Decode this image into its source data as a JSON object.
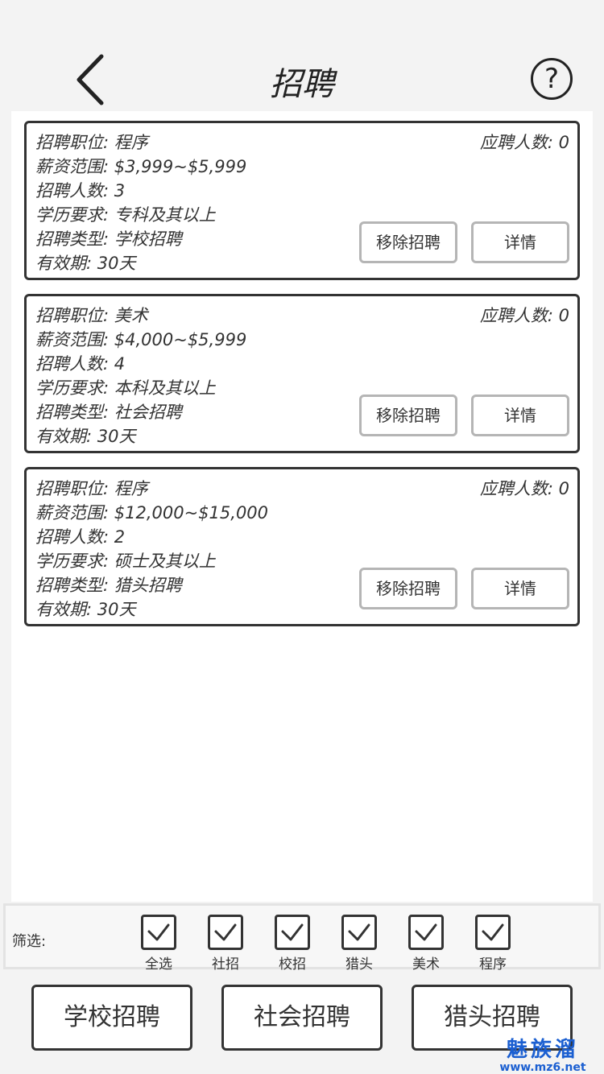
{
  "header": {
    "title": "招聘",
    "help_label": "?"
  },
  "jobs": [
    {
      "position": "招聘职位: 程序",
      "salary": "薪资范围: $3,999~$5,999",
      "headcount": "招聘人数: 3",
      "education": "学历要求: 专科及其以上",
      "type": "招聘类型: 学校招聘",
      "validity": "有效期: 30天",
      "applicants": "应聘人数: 0",
      "remove_label": "移除招聘",
      "detail_label": "详情"
    },
    {
      "position": "招聘职位: 美术",
      "salary": "薪资范围: $4,000~$5,999",
      "headcount": "招聘人数: 4",
      "education": "学历要求: 本科及其以上",
      "type": "招聘类型: 社会招聘",
      "validity": "有效期: 30天",
      "applicants": "应聘人数: 0",
      "remove_label": "移除招聘",
      "detail_label": "详情"
    },
    {
      "position": "招聘职位: 程序",
      "salary": "薪资范围: $12,000~$15,000",
      "headcount": "招聘人数: 2",
      "education": "学历要求: 硕士及其以上",
      "type": "招聘类型: 猎头招聘",
      "validity": "有效期: 30天",
      "applicants": "应聘人数: 0",
      "remove_label": "移除招聘",
      "detail_label": "详情"
    }
  ],
  "filter": {
    "label": "筛选:",
    "options": [
      {
        "label": "全选",
        "checked": true
      },
      {
        "label": "社招",
        "checked": true
      },
      {
        "label": "校招",
        "checked": true
      },
      {
        "label": "猎头",
        "checked": true
      },
      {
        "label": "美术",
        "checked": true
      },
      {
        "label": "程序",
        "checked": true
      }
    ]
  },
  "bottom_buttons": [
    "学校招聘",
    "社会招聘",
    "猎头招聘"
  ],
  "watermark": {
    "main": "魅族溜",
    "url": "www.mz6.net"
  }
}
